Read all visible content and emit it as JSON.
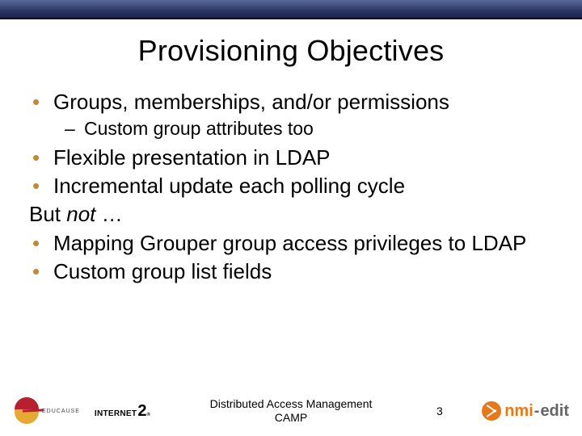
{
  "title": "Provisioning Objectives",
  "bullets": {
    "b1": "Groups, memberships, and/or permissions",
    "b1_sub1": "Custom group attributes too",
    "b2": "Flexible presentation in LDAP",
    "b3": "Incremental update each polling cycle",
    "but_prefix": "But ",
    "but_not": "not",
    "but_ellipsis": " …",
    "b4": "Mapping Grouper group access privileges to LDAP",
    "b5": "Custom group list fields"
  },
  "footer": {
    "center_line1": "Distributed Access Management",
    "center_line2": "CAMP",
    "page": "3"
  },
  "logos": {
    "educause": "EDUCAUSE",
    "internet2_word": "INTERNET",
    "internet2_num": "2",
    "internet2_r": "®",
    "nmi_a": "nmi",
    "nmi_dash": "-",
    "nmi_b": "edit"
  }
}
